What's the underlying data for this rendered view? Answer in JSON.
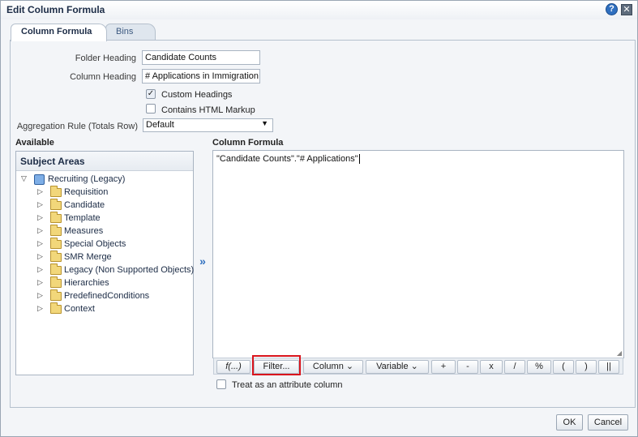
{
  "dialog": {
    "title": "Edit Column Formula",
    "help_symbol": "?",
    "close_symbol": "✕"
  },
  "tabs": [
    {
      "label": "Column Formula",
      "active": true
    },
    {
      "label": "Bins",
      "active": false
    }
  ],
  "form": {
    "folder_heading_label": "Folder Heading",
    "folder_heading_value": "Candidate Counts",
    "column_heading_label": "Column Heading",
    "column_heading_value": "# Applications in Immigration",
    "custom_headings_label": "Custom Headings",
    "custom_headings_checked": true,
    "html_markup_label": "Contains HTML Markup",
    "html_markup_checked": false,
    "aggregation_label": "Aggregation Rule (Totals Row)",
    "aggregation_value": "Default"
  },
  "available": {
    "label": "Available",
    "header": "Subject Areas",
    "root": "Recruiting (Legacy)",
    "items": [
      "Requisition",
      "Candidate",
      "Template",
      "Measures",
      "Special Objects",
      "SMR Merge",
      "Legacy (Non Supported Objects)",
      "Hierarchies",
      "PredefinedConditions",
      "Context"
    ]
  },
  "formula": {
    "label": "Column Formula",
    "text": "\"Candidate Counts\".\"# Applications\"",
    "toolbar": {
      "f": "f(...)",
      "filter": "Filter...",
      "column": "Column ⌄",
      "variable": "Variable ⌄",
      "plus": "+",
      "minus": "-",
      "times": "x",
      "divide": "/",
      "percent": "%",
      "lparen": "(",
      "rparen": ")",
      "concat": "||"
    },
    "attribute_label": "Treat as an attribute column",
    "attribute_checked": false
  },
  "footer": {
    "ok": "OK",
    "cancel": "Cancel"
  },
  "colors": {
    "highlight": "#d9141c",
    "accent": "#2f6fbf"
  }
}
